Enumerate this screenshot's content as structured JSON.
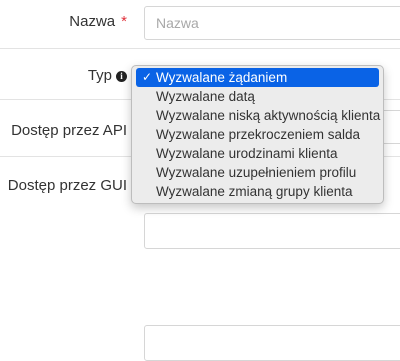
{
  "form": {
    "name_label": "Nazwa",
    "required_mark": "*",
    "name_placeholder": "Nazwa",
    "type_label": "Typ",
    "info_glyph": "i",
    "api_access_label": "Dostęp przez API",
    "gui_access_label": "Dostęp przez GUI"
  },
  "dropdown": {
    "check_glyph": "✓",
    "selected_index": 0,
    "selected_color": "#0a63e6",
    "options": [
      "Wyzwalane żądaniem",
      "Wyzwalane datą",
      "Wyzwalane niską aktywnością klienta",
      "Wyzwalane przekroczeniem salda",
      "Wyzwalane urodzinami klienta",
      "Wyzwalane uzupełnieniem profilu",
      "Wyzwalane zmianą grupy klienta"
    ]
  }
}
